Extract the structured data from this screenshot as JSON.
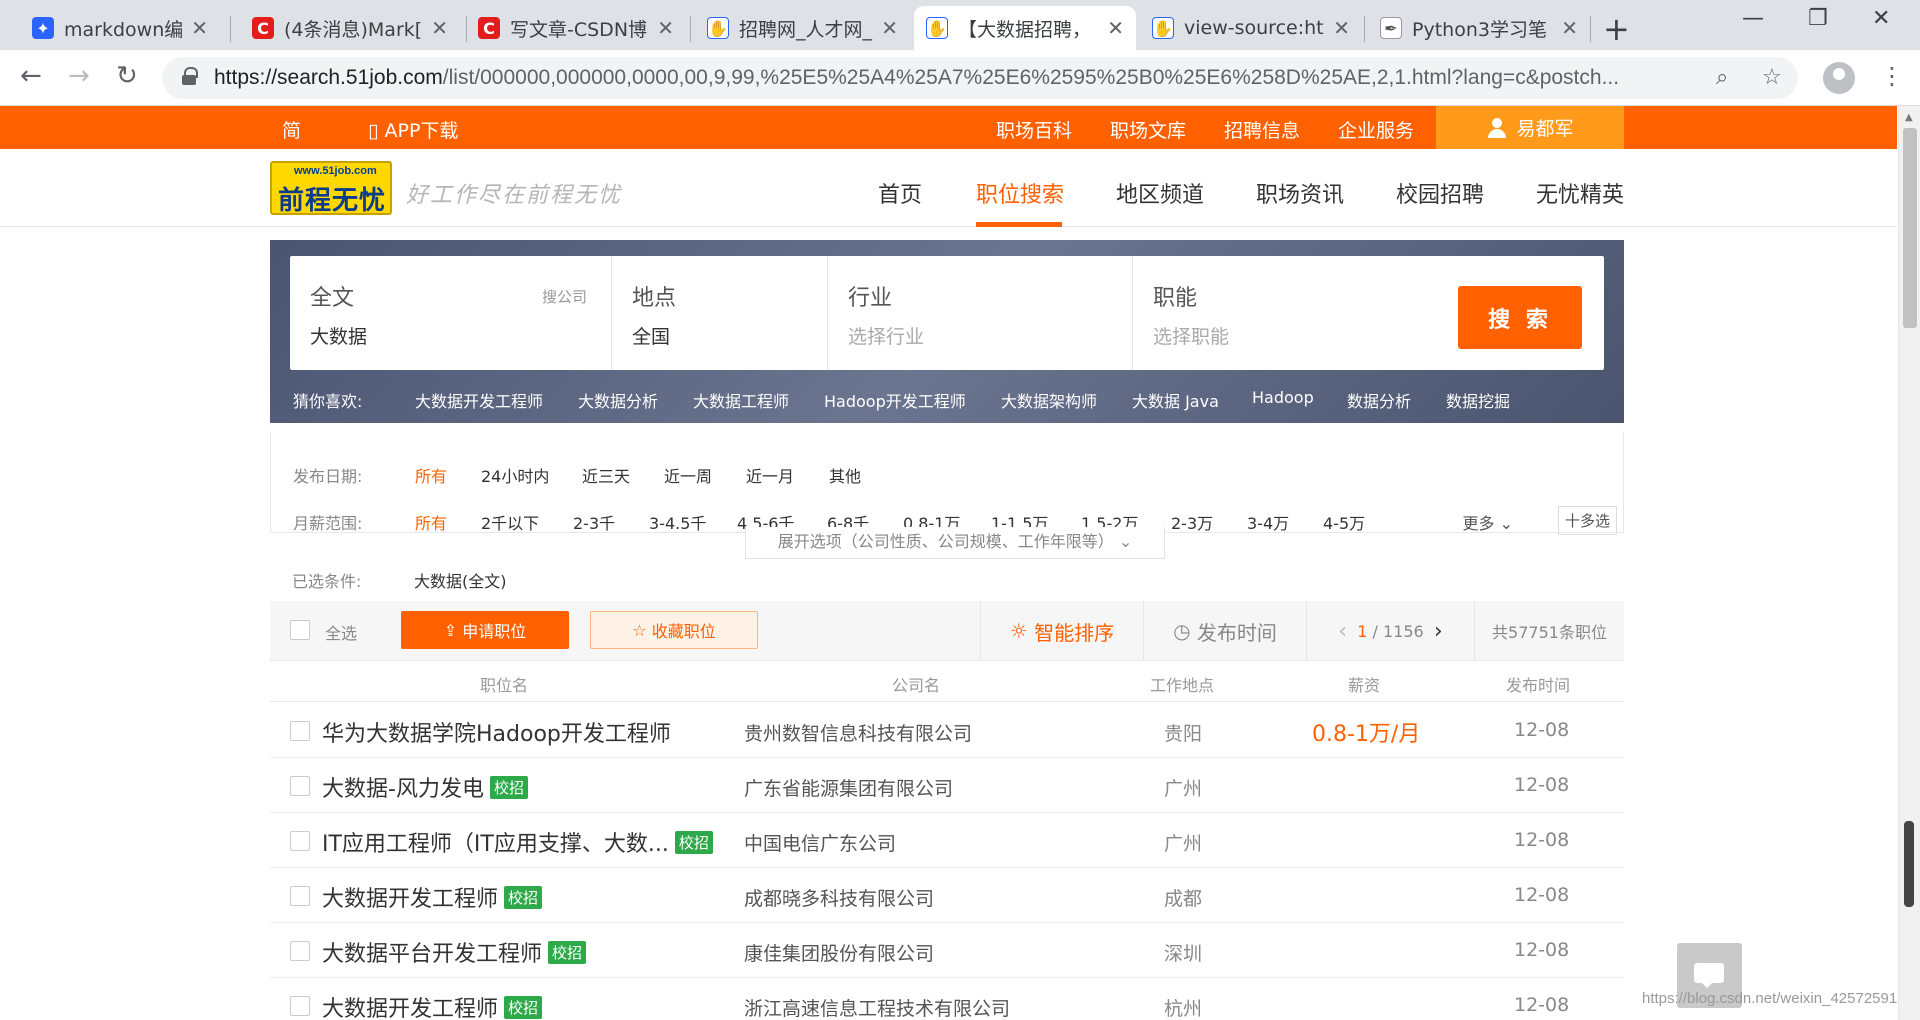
{
  "browser": {
    "tabs": [
      {
        "title": "markdown编辑",
        "icon": "baidu-paw-icon",
        "color": "#2b63ff"
      },
      {
        "title": "(4条消息)Mark[",
        "icon": "csdn-icon",
        "color": "#e31c1c"
      },
      {
        "title": "写文章-CSDN博",
        "icon": "csdn-icon",
        "color": "#e31c1c"
      },
      {
        "title": "招聘网_人才网_",
        "icon": "hand-icon",
        "color": "#2b63ff"
      },
      {
        "title": "【大数据招聘，",
        "icon": "hand-icon",
        "color": "#2b63ff"
      },
      {
        "title": "view-source:ht",
        "icon": "hand-icon",
        "color": "#2b63ff"
      },
      {
        "title": "Python3学习笔",
        "icon": "feather-icon",
        "color": "#555555"
      }
    ],
    "url_host": "https://search.51job.com",
    "url_rest": "/list/000000,000000,0000,00,9,99,%25E5%25A4%25A7%25E6%2595%25B0%25E6%258D%25AE,2,1.html?lang=c&postch..."
  },
  "topbar": {
    "simplified": "简",
    "app_download": "APP下载",
    "links": [
      "职场百科",
      "职场文库",
      "招聘信息",
      "企业服务"
    ],
    "user": "易都军"
  },
  "header": {
    "logo_small": "www.51job.com",
    "logo_big": "前程无忧",
    "slogan": "好工作尽在前程无忧",
    "nav": [
      "首页",
      "职位搜索",
      "地区频道",
      "职场资讯",
      "校园招聘",
      "无忧精英"
    ]
  },
  "search": {
    "fields": [
      {
        "label": "全文",
        "value": "大数据",
        "aside": "搜公司"
      },
      {
        "label": "地点",
        "value": "全国"
      },
      {
        "label": "行业",
        "placeholder": "选择行业"
      },
      {
        "label": "职能",
        "placeholder": "选择职能"
      }
    ],
    "button": "搜 索",
    "guess_label": "猜你喜欢:",
    "guess": [
      "大数据开发工程师",
      "大数据分析",
      "大数据工程师",
      "Hadoop开发工程师",
      "大数据架构师",
      "大数据 Java",
      "Hadoop",
      "数据分析",
      "数据挖掘"
    ]
  },
  "filters": {
    "date_label": "发布日期:",
    "date_options": [
      "所有",
      "24小时内",
      "近三天",
      "近一周",
      "近一月",
      "其他"
    ],
    "salary_label": "月薪范围:",
    "salary_options": [
      "所有",
      "2千以下",
      "2-3千",
      "3-4.5千",
      "4.5-6千",
      "6-8千",
      "0.8-1万",
      "1-1.5万",
      "1.5-2万",
      "2-3万",
      "3-4万",
      "4-5万"
    ],
    "more": "更多",
    "multi": "十多选",
    "expand": "展开选项（公司性质、公司规模、工作年限等）",
    "chosen_label": "已选条件:",
    "chosen_value": "大数据(全文)"
  },
  "actions": {
    "select_all": "全选",
    "apply": "申请职位",
    "favorite": "收藏职位",
    "smart_sort": "智能排序",
    "publish_time": "发布时间",
    "page_current": "1",
    "page_total": "/ 1156",
    "total": "共57751条职位"
  },
  "table": {
    "headers": [
      "职位名",
      "公司名",
      "工作地点",
      "薪资",
      "发布时间"
    ],
    "rows": [
      {
        "title": "华为大数据学院Hadoop开发工程师",
        "tag": "",
        "company": "贵州数智信息科技有限公司",
        "location": "贵阳",
        "salary": "0.8-1万/月",
        "date": "12-08"
      },
      {
        "title": "大数据-风力发电",
        "tag": "校招",
        "company": "广东省能源集团有限公司",
        "location": "广州",
        "salary": "",
        "date": "12-08"
      },
      {
        "title": "IT应用工程师（IT应用支撑、大数...",
        "tag": "校招",
        "company": "中国电信广东公司",
        "location": "广州",
        "salary": "",
        "date": "12-08"
      },
      {
        "title": "大数据开发工程师",
        "tag": "校招",
        "company": "成都晓多科技有限公司",
        "location": "成都",
        "salary": "",
        "date": "12-08"
      },
      {
        "title": "大数据平台开发工程师",
        "tag": "校招",
        "company": "康佳集团股份有限公司",
        "location": "深圳",
        "salary": "",
        "date": "12-08"
      },
      {
        "title": "大数据开发工程师",
        "tag": "校招",
        "company": "浙江高速信息工程技术有限公司",
        "location": "杭州",
        "salary": "",
        "date": "12-08"
      }
    ]
  },
  "watermark": "https://blog.csdn.net/weixin_42572591",
  "colors": {
    "brand": "#ff6000",
    "tag_green": "#2ea94a",
    "user_bg": "#ff9a1a"
  }
}
